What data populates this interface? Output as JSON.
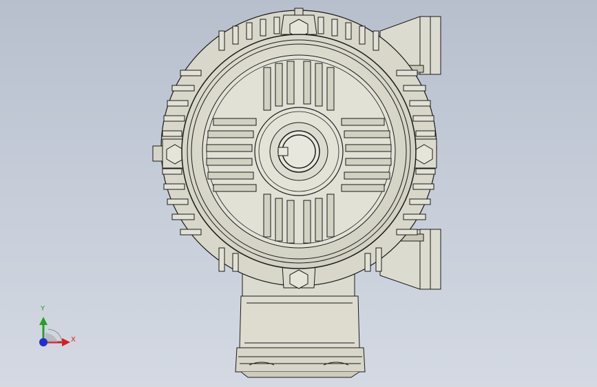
{
  "viewport": {
    "background_top": "#b7bfcd",
    "background_bottom": "#d4d9e2"
  },
  "model": {
    "part": "motor-end-view",
    "body_color": "#deddd0",
    "shade_color": "#c9c8b8",
    "edge_color": "#1a1a1a"
  },
  "triad": {
    "x_label": "X",
    "y_label": "Y",
    "x_color": "#d42020",
    "y_color": "#23a323",
    "z_color": "#2030d0"
  }
}
